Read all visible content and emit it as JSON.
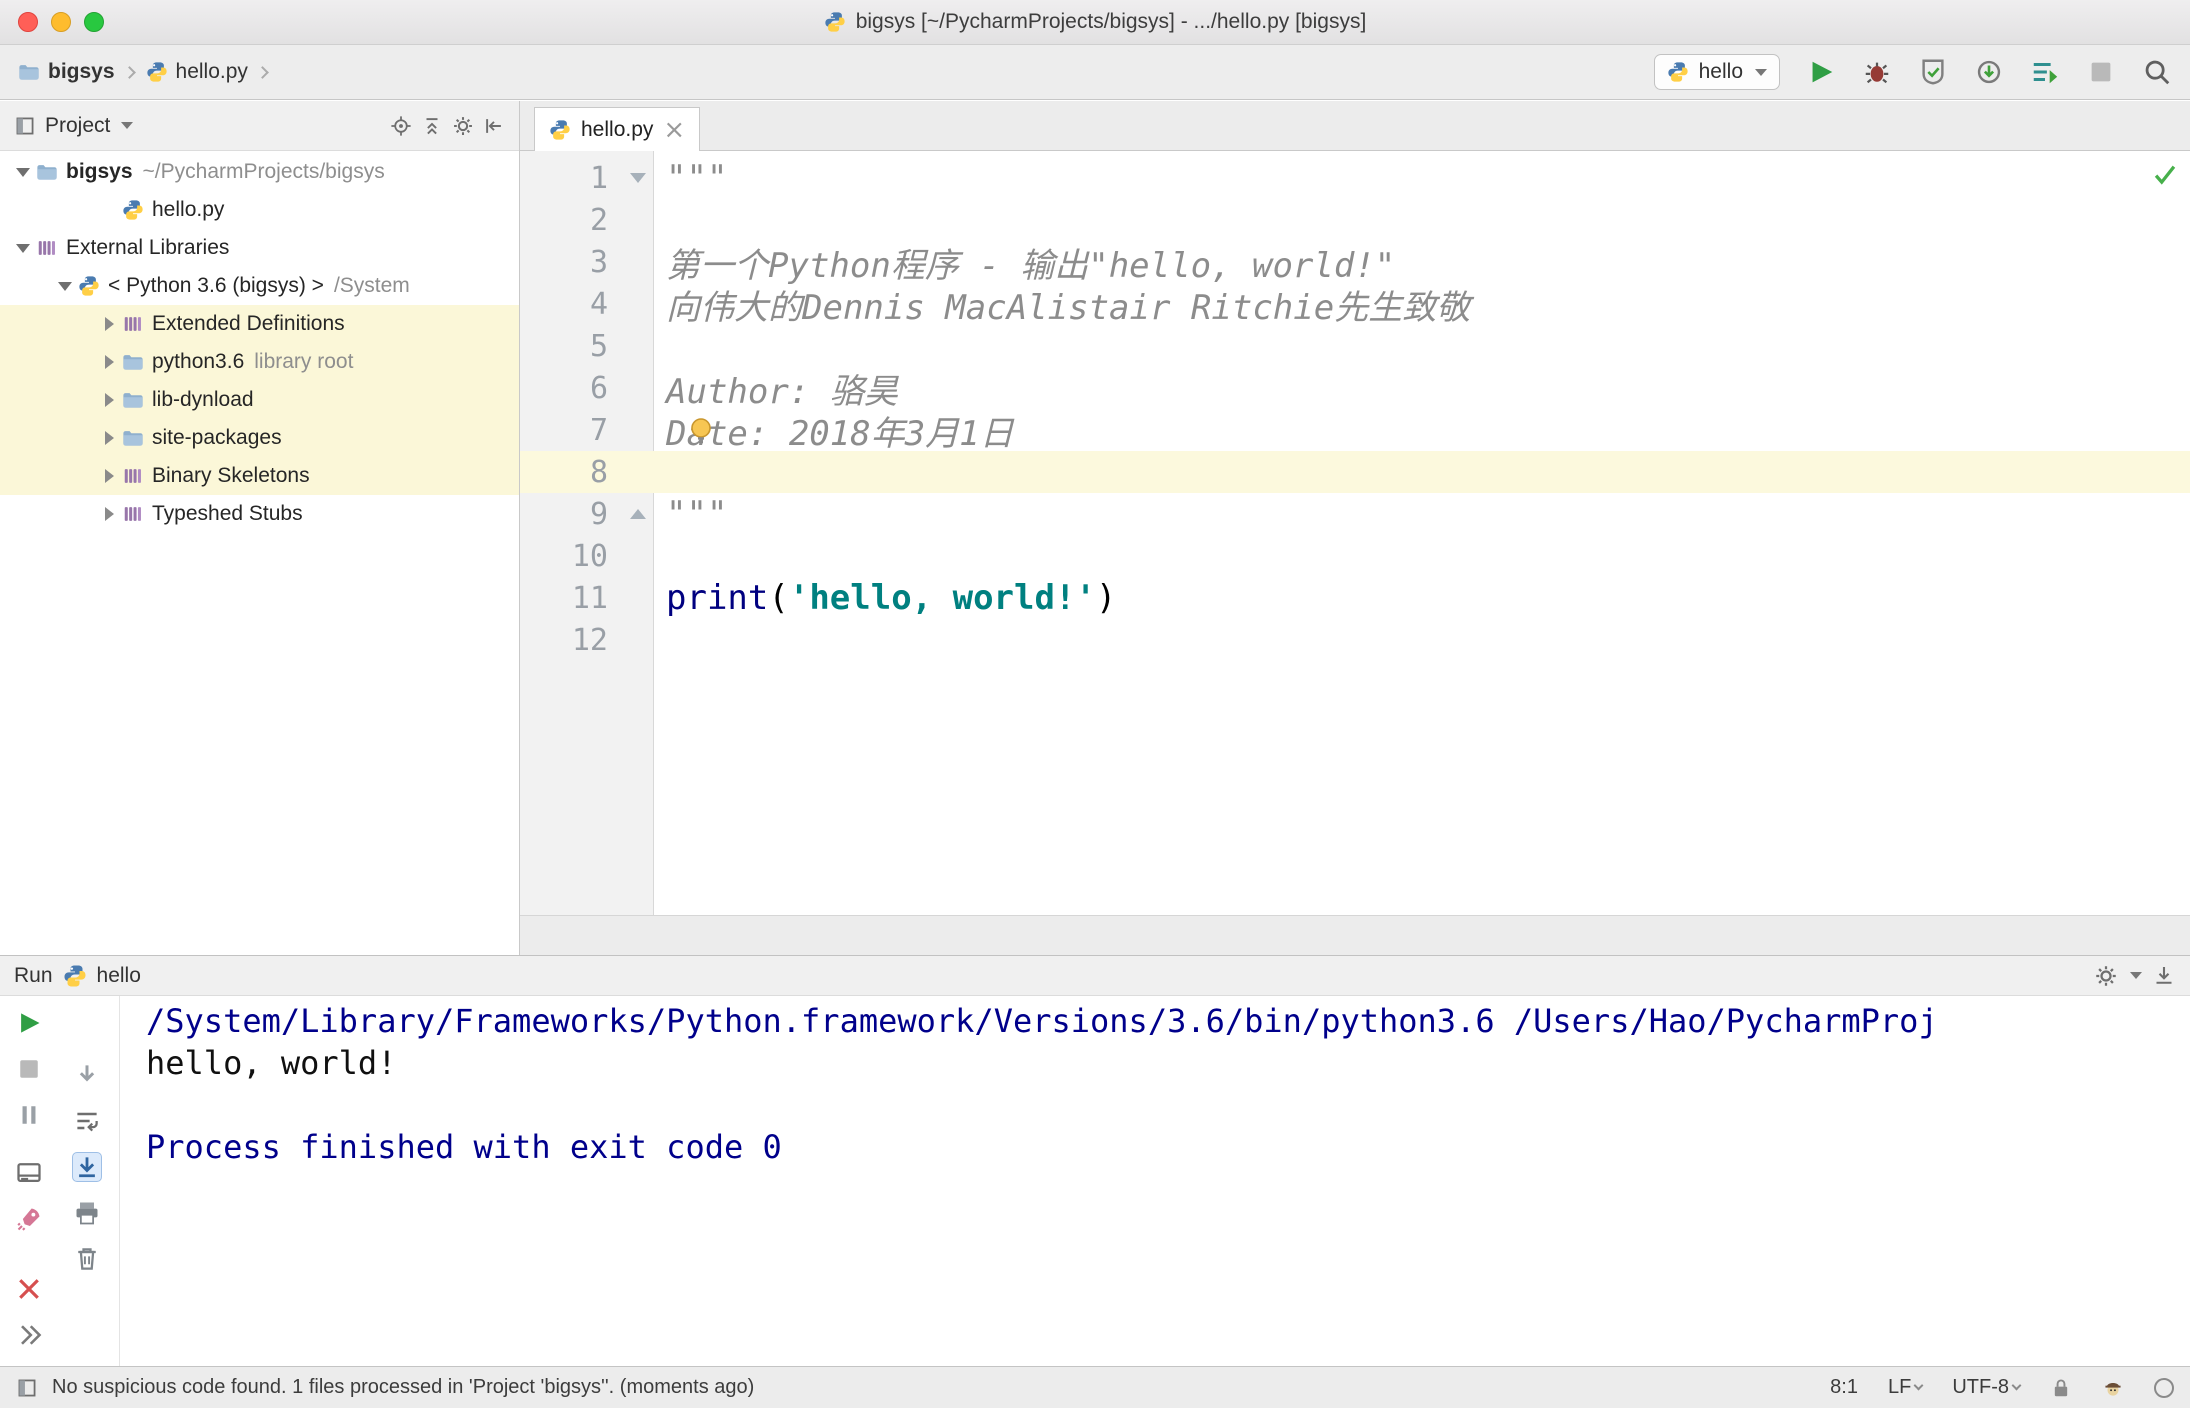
{
  "window": {
    "title": "bigsys [~/PycharmProjects/bigsys] - .../hello.py [bigsys]"
  },
  "navbar": {
    "breadcrumbs": [
      "bigsys",
      "hello.py"
    ],
    "run_config": "hello"
  },
  "project_panel": {
    "title": "Project",
    "tree": [
      {
        "label": "bigsys",
        "suffix": "~/PycharmProjects/bigsys"
      },
      {
        "label": "hello.py"
      },
      {
        "label": "External Libraries"
      },
      {
        "label": "< Python 3.6 (bigsys) >",
        "suffix": "/System"
      },
      {
        "label": "Extended Definitions"
      },
      {
        "label": "python3.6",
        "suffix": "library root"
      },
      {
        "label": "lib-dynload"
      },
      {
        "label": "site-packages"
      },
      {
        "label": "Binary Skeletons"
      },
      {
        "label": "Typeshed Stubs"
      }
    ]
  },
  "editor": {
    "tab": "hello.py",
    "lines": [
      {
        "num": "1",
        "text": "\"\"\""
      },
      {
        "num": "2",
        "text": ""
      },
      {
        "num": "3",
        "text": "第一个Python程序 - 输出\"hello, world!\""
      },
      {
        "num": "4",
        "text": "向伟大的Dennis MacAlistair Ritchie先生致敬"
      },
      {
        "num": "5",
        "text": ""
      },
      {
        "num": "6",
        "text": "Author: 骆昊"
      },
      {
        "num": "7",
        "text": "Date: 2018年3月1日"
      },
      {
        "num": "8",
        "text": ""
      },
      {
        "num": "9",
        "text": "\"\"\""
      },
      {
        "num": "10",
        "text": ""
      },
      {
        "num": "11",
        "tokens": {
          "kw": "print",
          "open": "(",
          "str": "'hello, world!'",
          "close": ")"
        }
      },
      {
        "num": "12",
        "text": ""
      }
    ]
  },
  "run_panel": {
    "title": "Run",
    "config": "hello",
    "console": [
      "/System/Library/Frameworks/Python.framework/Versions/3.6/bin/python3.6 /Users/Hao/PycharmProj",
      "hello, world!",
      "",
      "Process finished with exit code 0"
    ]
  },
  "statusbar": {
    "message": "No suspicious code found. 1 files processed in 'Project 'bigsys''. (moments ago)",
    "caret": "8:1",
    "line_sep": "LF",
    "encoding": "UTF-8"
  },
  "icons": {
    "close": "×"
  },
  "colors": {
    "keyword": "#000080",
    "string": "#008080",
    "comment": "#8c8c8c",
    "console_system": "#00008b",
    "current_line": "#fcf9dd",
    "tree_highlight": "#fbf7d8",
    "run_green": "#2f9e44"
  }
}
